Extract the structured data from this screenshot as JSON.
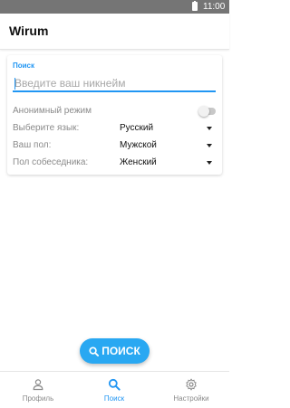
{
  "status_bar": {
    "time": "11:00",
    "icon": "battery-icon"
  },
  "app_bar": {
    "title": "Wirum"
  },
  "search_form": {
    "section_label": "Поиск",
    "nickname_placeholder": "Введите ваш никнейм",
    "nickname_value": "",
    "anonymous_label": "Анонимный режим",
    "anonymous_enabled": false,
    "language_label": "Выберите язык:",
    "language_value": "Русский",
    "gender_label": "Ваш пол:",
    "gender_value": "Мужской",
    "partner_gender_label": "Пол собеседника:",
    "partner_gender_value": "Женский"
  },
  "search_button": {
    "label": "ПОИСК",
    "icon": "search-icon"
  },
  "bottom_nav": {
    "items": [
      {
        "label": "Профиль",
        "icon": "person-icon",
        "active": false
      },
      {
        "label": "Поиск",
        "icon": "search-icon",
        "active": true
      },
      {
        "label": "Настройки",
        "icon": "gear-icon",
        "active": false
      }
    ]
  },
  "colors": {
    "accent": "#2196f3",
    "fab": "#29a8f2",
    "status_bar": "#757575"
  }
}
